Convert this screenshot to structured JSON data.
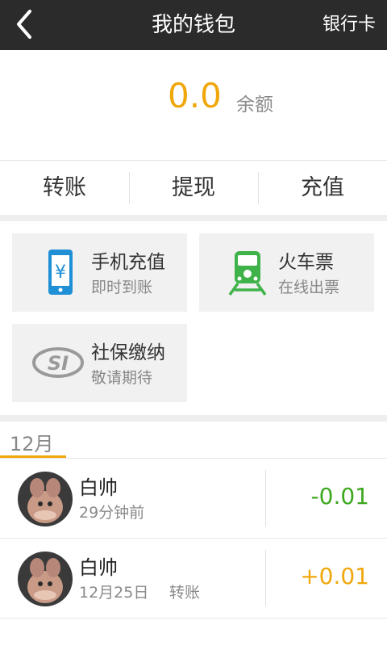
{
  "header": {
    "title": "我的钱包",
    "right_label": "银行卡"
  },
  "balance": {
    "value": "0.0",
    "label": "余额"
  },
  "actions": [
    {
      "label": "转账"
    },
    {
      "label": "提现"
    },
    {
      "label": "充值"
    }
  ],
  "services": [
    {
      "title": "手机充值",
      "subtitle": "即时到账",
      "icon": "phone-yuan-icon"
    },
    {
      "title": "火车票",
      "subtitle": "在线出票",
      "icon": "train-icon"
    },
    {
      "title": "社保缴纳",
      "subtitle": "敬请期待",
      "icon": "si-logo-icon"
    }
  ],
  "month": {
    "label": "12月",
    "accent": "#f0a70a"
  },
  "transactions": [
    {
      "name": "白帅",
      "time": "29分钟前",
      "type": "",
      "amount": "-0.01",
      "amount_color": "#3ea81f"
    },
    {
      "name": "白帅",
      "time": "12月25日",
      "type": "转账",
      "amount": "+0.01",
      "amount_color": "#f0a70a"
    }
  ],
  "colors": {
    "header_bg": "#2b2b2b",
    "accent": "#f0a70a",
    "negative": "#3ea81f",
    "tile_bg": "#f1f1f1"
  }
}
